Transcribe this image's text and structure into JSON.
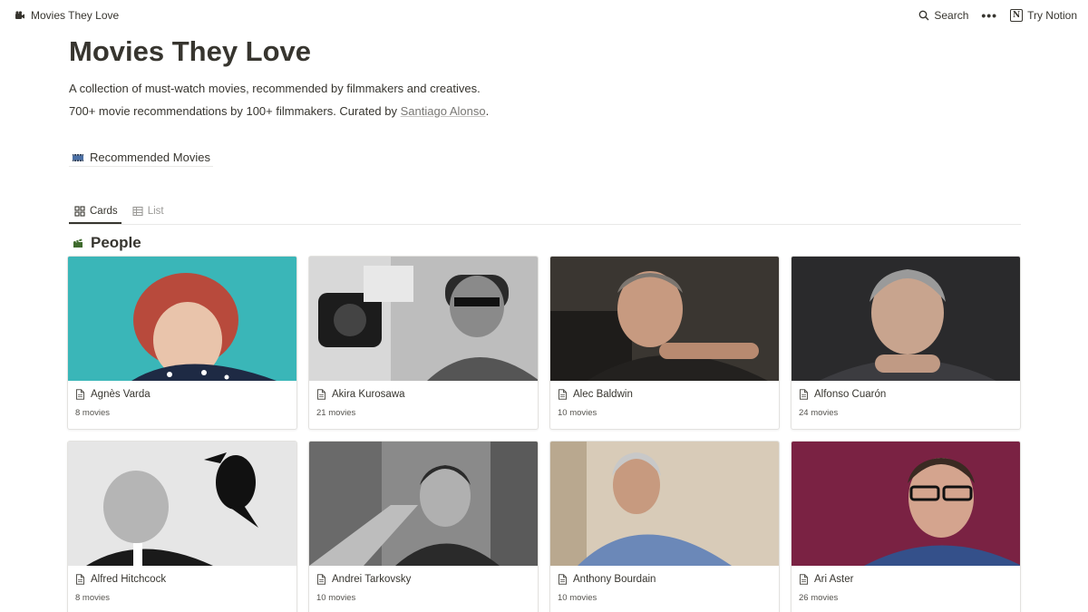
{
  "topbar": {
    "breadcrumb_title": "Movies They Love",
    "search_label": "Search",
    "more_label": "•••",
    "try_label": "Try Notion",
    "notion_letter": "N"
  },
  "page": {
    "title": "Movies They Love",
    "description": "A collection of must-watch movies, recommended by filmmakers and creatives.",
    "subdescription_prefix": "700+ movie recommendations by 100+ filmmakers. Curated by ",
    "curator": "Santiago Alonso",
    "subdescription_suffix": ".",
    "linked_page": "Recommended Movies"
  },
  "views": {
    "tabs": [
      {
        "label": "Cards",
        "icon": "grid-icon",
        "active": true
      },
      {
        "label": "List",
        "icon": "table-icon",
        "active": false
      }
    ]
  },
  "group": {
    "title": "People",
    "icon": "clapper-icon"
  },
  "cards": [
    {
      "name": "Agnès Varda",
      "count": "8 movies",
      "bg": "#3ab6b8"
    },
    {
      "name": "Akira Kurosawa",
      "count": "21 movies",
      "bg": "#9a9a9a"
    },
    {
      "name": "Alec Baldwin",
      "count": "10 movies",
      "bg": "#3a3631"
    },
    {
      "name": "Alfonso Cuarón",
      "count": "24 movies",
      "bg": "#2a2a2c"
    },
    {
      "name": "Alfred Hitchcock",
      "count": "8 movies",
      "bg": "#e6e6e6"
    },
    {
      "name": "Andrei Tarkovsky",
      "count": "10 movies",
      "bg": "#8a8a8a"
    },
    {
      "name": "Anthony Bourdain",
      "count": "10 movies",
      "bg": "#c9b9a5"
    },
    {
      "name": "Ari Aster",
      "count": "26 movies",
      "bg": "#7a2243"
    }
  ]
}
